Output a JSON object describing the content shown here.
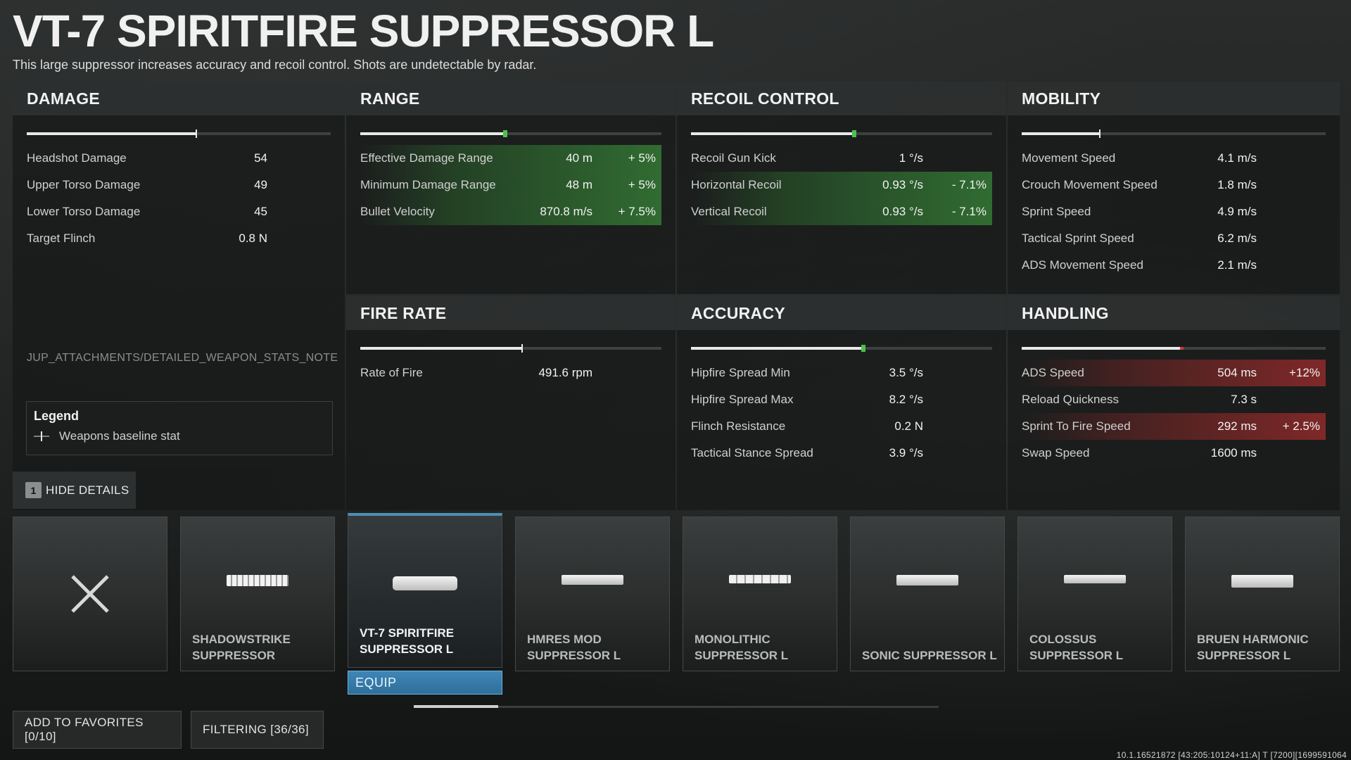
{
  "header": {
    "title": "VT-7 SPIRITFIRE SUPPRESSOR L",
    "description": "This large suppressor increases accuracy and recoil control. Shots are undetectable by radar."
  },
  "colors": {
    "positive": "#4cc24c",
    "negative": "#d23a34",
    "selected": "#4d8fb8"
  },
  "stats": {
    "damage": {
      "title": "DAMAGE",
      "bar_level": 0.56,
      "rows": [
        {
          "label": "Headshot Damage",
          "value": "54"
        },
        {
          "label": "Upper Torso Damage",
          "value": "49"
        },
        {
          "label": "Lower Torso Damage",
          "value": "45"
        },
        {
          "label": "Target Flinch",
          "value": "0.8 N"
        }
      ]
    },
    "range": {
      "title": "RANGE",
      "bar_level": 0.48,
      "rows": [
        {
          "label": "Effective Damage Range",
          "value": "40 m",
          "change": "+ 5%"
        },
        {
          "label": "Minimum Damage Range",
          "value": "48 m",
          "change": "+ 5%"
        },
        {
          "label": "Bullet Velocity",
          "value": "870.8 m/s",
          "change": "+ 7.5%"
        }
      ]
    },
    "recoil": {
      "title": "RECOIL CONTROL",
      "bar_level": 0.54,
      "rows": [
        {
          "label": "Recoil Gun Kick",
          "value": "1 °/s"
        },
        {
          "label": "Horizontal Recoil",
          "value": "0.93 °/s",
          "change": "- 7.1%"
        },
        {
          "label": "Vertical Recoil",
          "value": "0.93 °/s",
          "change": "- 7.1%"
        }
      ]
    },
    "mobility": {
      "title": "MOBILITY",
      "bar_level": 0.26,
      "rows": [
        {
          "label": "Movement Speed",
          "value": "4.1 m/s"
        },
        {
          "label": "Crouch Movement Speed",
          "value": "1.8 m/s"
        },
        {
          "label": "Sprint Speed",
          "value": "4.9 m/s"
        },
        {
          "label": "Tactical Sprint Speed",
          "value": "6.2 m/s"
        },
        {
          "label": "ADS Movement Speed",
          "value": "2.1 m/s"
        }
      ]
    },
    "fire_rate": {
      "title": "FIRE RATE",
      "bar_level": 0.54,
      "rows": [
        {
          "label": "Rate of Fire",
          "value": "491.6 rpm"
        }
      ]
    },
    "accuracy": {
      "title": "ACCURACY",
      "bar_level": 0.57,
      "rows": [
        {
          "label": "Hipfire Spread Min",
          "value": "3.5 °/s"
        },
        {
          "label": "Hipfire Spread Max",
          "value": "8.2 °/s"
        },
        {
          "label": "Flinch Resistance",
          "value": "0.2 N"
        },
        {
          "label": "Tactical Stance Spread",
          "value": "3.9 °/s"
        }
      ]
    },
    "handling": {
      "title": "HANDLING",
      "bar_level": 0.52,
      "rows": [
        {
          "label": "ADS Speed",
          "value": "504 ms",
          "change": "+12%"
        },
        {
          "label": "Reload Quickness",
          "value": "7.3 s"
        },
        {
          "label": "Sprint To Fire Speed",
          "value": "292 ms",
          "change": "+ 2.5%"
        },
        {
          "label": "Swap Speed",
          "value": "1600 ms"
        }
      ]
    }
  },
  "note": "JUP_ATTACHMENTS/DETAILED_WEAPON_STATS_NOTE",
  "legend": {
    "title": "Legend",
    "item": "Weapons baseline stat"
  },
  "hide_details": {
    "key": "1",
    "label": "HIDE DETAILS"
  },
  "attachments": [
    {
      "name": "",
      "icon": "none-x-icon"
    },
    {
      "name": "SHADOWSTRIKE SUPPRESSOR",
      "icon": "suppressor-icon"
    },
    {
      "name": "VT-7 SPIRITFIRE SUPPRESSOR L",
      "icon": "suppressor-icon",
      "selected": true
    },
    {
      "name": "HMRES MOD SUPPRESSOR L",
      "icon": "suppressor-icon"
    },
    {
      "name": "MONOLITHIC SUPPRESSOR L",
      "icon": "suppressor-icon"
    },
    {
      "name": "SONIC SUPPRESSOR L",
      "icon": "suppressor-icon"
    },
    {
      "name": "COLOSSUS SUPPRESSOR L",
      "icon": "suppressor-icon"
    },
    {
      "name": "BRUEN HARMONIC SUPPRESSOR L",
      "icon": "suppressor-icon"
    }
  ],
  "equip_label": "EQUIP",
  "scroll_position": 0.16,
  "buttons": {
    "favorites": "ADD TO FAVORITES [0/10]",
    "filtering": "FILTERING [36/36]"
  },
  "version": "10.1.16521872 [43:205:10124+11:A] T [7200][1699591064"
}
